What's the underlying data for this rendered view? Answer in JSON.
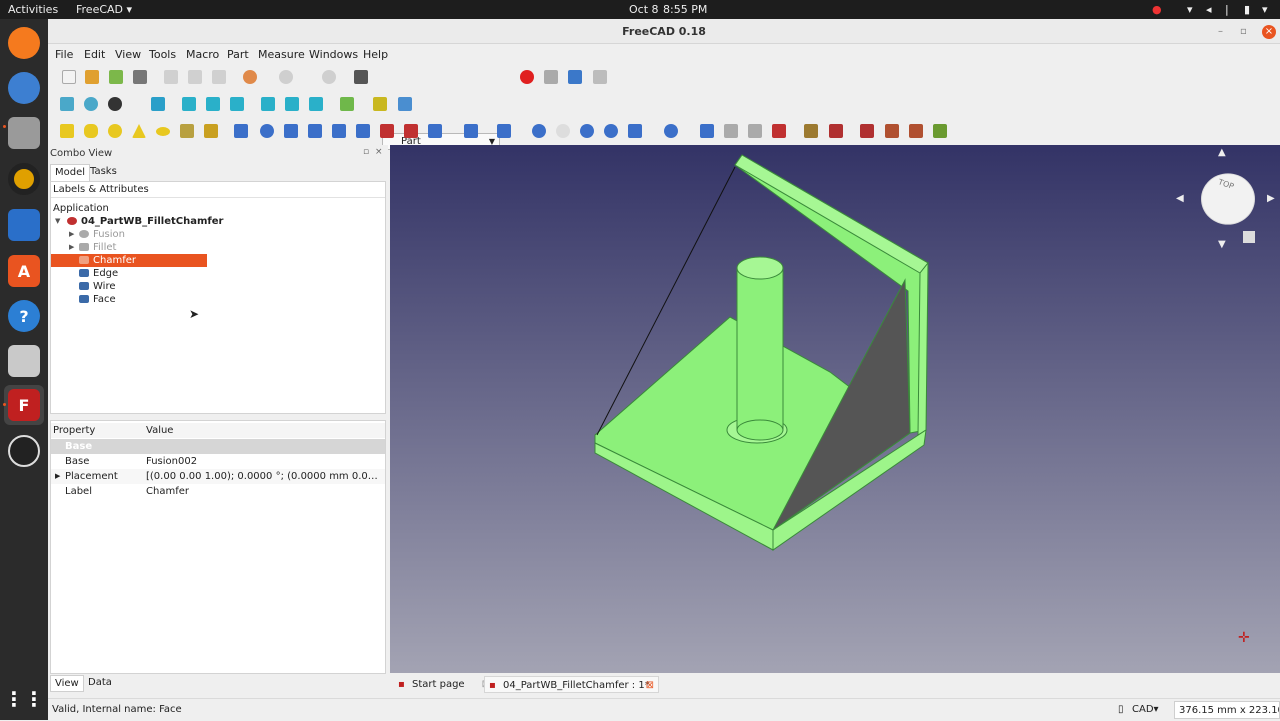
{
  "gnome": {
    "activities": "Activities",
    "app_name": "FreeCAD ▾",
    "date": "Oct 8",
    "time": "8:55 PM"
  },
  "window": {
    "title": "FreeCAD 0.18"
  },
  "menu": {
    "file": "File",
    "edit": "Edit",
    "view": "View",
    "tools": "Tools",
    "macro": "Macro",
    "part": "Part",
    "measure": "Measure",
    "windows": "Windows",
    "help": "Help"
  },
  "toolbar": {
    "workbench": "Part"
  },
  "combo_view": {
    "title": "Combo View",
    "tab_model": "Model",
    "tab_tasks": "Tasks",
    "tree_header": "Labels & Attributes",
    "application": "Application",
    "document": "04_PartWB_FilletChamfer",
    "items": [
      {
        "label": "Fusion"
      },
      {
        "label": "Fillet"
      },
      {
        "label": "Chamfer"
      },
      {
        "label": "Edge"
      },
      {
        "label": "Wire"
      },
      {
        "label": "Face"
      }
    ]
  },
  "properties": {
    "col_property": "Property",
    "col_value": "Value",
    "group": "Base",
    "rows": [
      {
        "key": "Base",
        "value": "Fusion002"
      },
      {
        "key": "Placement",
        "value": "[(0.00 0.00 1.00); 0.0000 °; (0.0000 mm  0.0000 m..."
      },
      {
        "key": "Label",
        "value": "Chamfer"
      }
    ],
    "tab_view": "View",
    "tab_data": "Data"
  },
  "doc_tabs": {
    "start": "Start page",
    "doc": "04_PartWB_FilletChamfer : 1*"
  },
  "status": {
    "message": "Valid, Internal name: Face",
    "nav_style": "CAD▾",
    "dimensions": "376.15 mm x 223.10 mm"
  },
  "navcube": {
    "face": "TOP"
  }
}
